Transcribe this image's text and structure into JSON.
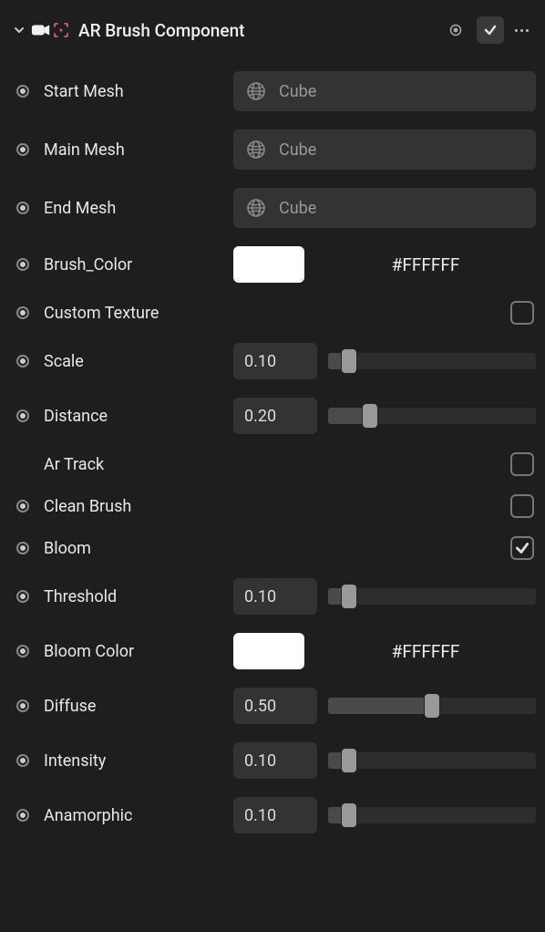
{
  "header": {
    "title": "AR Brush Component"
  },
  "rows": {
    "start_mesh": {
      "label": "Start Mesh",
      "value": "Cube"
    },
    "main_mesh": {
      "label": "Main Mesh",
      "value": "Cube"
    },
    "end_mesh": {
      "label": "End Mesh",
      "value": "Cube"
    },
    "brush_color": {
      "label": "Brush_Color",
      "hex": "#FFFFFF",
      "swatch": "#FFFFFF"
    },
    "custom_texture": {
      "label": "Custom Texture",
      "checked": false
    },
    "scale": {
      "label": "Scale",
      "value": "0.10",
      "pct": 10
    },
    "distance": {
      "label": "Distance",
      "value": "0.20",
      "pct": 20
    },
    "ar_track": {
      "label": "Ar Track",
      "checked": false
    },
    "clean_brush": {
      "label": "Clean Brush",
      "checked": false
    },
    "bloom": {
      "label": "Bloom",
      "checked": true
    },
    "threshold": {
      "label": "Threshold",
      "value": "0.10",
      "pct": 10
    },
    "bloom_color": {
      "label": "Bloom Color",
      "hex": "#FFFFFF",
      "swatch": "#FFFFFF"
    },
    "diffuse": {
      "label": "Diffuse",
      "value": "0.50",
      "pct": 50
    },
    "intensity": {
      "label": "Intensity",
      "value": "0.10",
      "pct": 10
    },
    "anamorphic": {
      "label": "Anamorphic",
      "value": "0.10",
      "pct": 10
    }
  }
}
